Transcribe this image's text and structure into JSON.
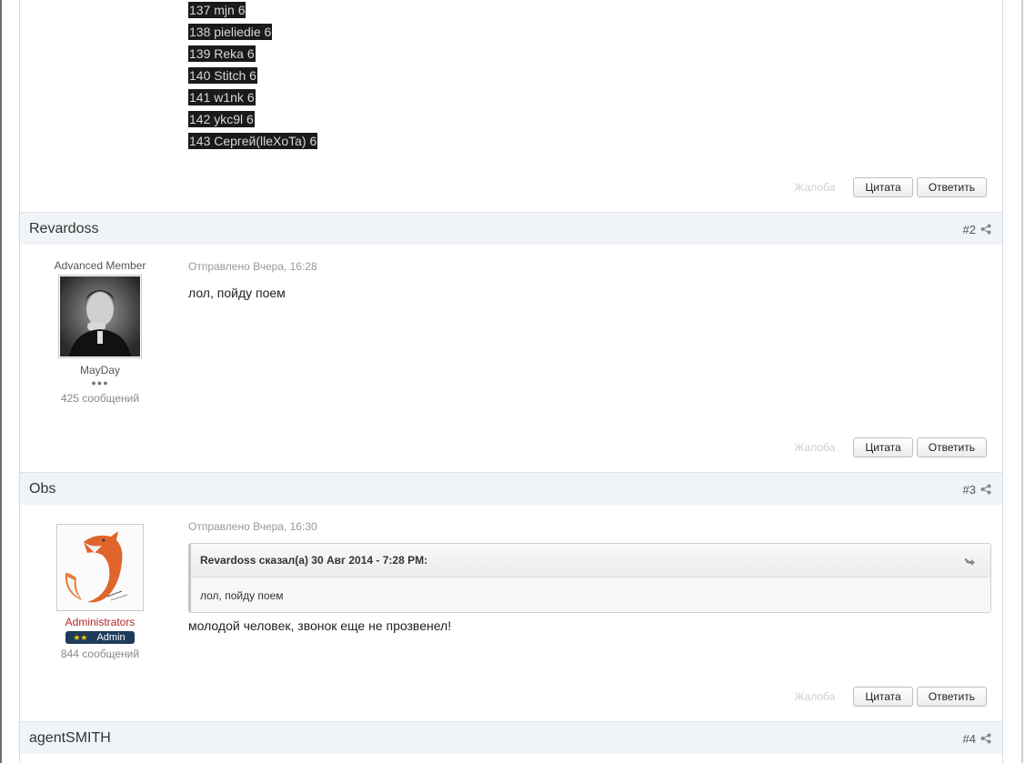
{
  "spoiler_lines": [
    "137 mjn 6",
    "138 pieliedie 6",
    "139 Reka 6",
    "140 Stitch 6",
    "141 w1nk 6",
    "142 ykc9l 6",
    "143 Сергей(lleXoTa) 6"
  ],
  "actions": {
    "report": "Жалоба",
    "quote": "Цитата",
    "reply": "Ответить"
  },
  "posts": [
    {
      "author": "Revardoss",
      "number": "#2",
      "user_title": "Advanced Member",
      "username": "MayDay",
      "pips": "●●●",
      "post_count": "425 сообщений",
      "meta": "Отправлено Вчера, 16:28",
      "text": "лол, пойду поем"
    },
    {
      "author": "Obs",
      "number": "#3",
      "group": "Administrators",
      "badge": "Admin",
      "badge_stars": "★★",
      "post_count": "844 сообщений",
      "meta": "Отправлено Вчера, 16:30",
      "quote_header": "Revardoss сказал(а) 30 Авг 2014 - 7:28 PM:",
      "quote_text": "лол, пойду поем",
      "text": "молодой человек, звонок еще не прозвенел!"
    },
    {
      "author": "agentSMITH",
      "number": "#4"
    }
  ],
  "colors": {
    "header_bg": "#f0f4f7",
    "spoiler_bg": "#1a1a1a",
    "admin_badge": "#1f3b5c",
    "group_red": "#b2262b"
  },
  "icons": {
    "share": "share-icon",
    "quote": "quote-arrow-icon"
  }
}
